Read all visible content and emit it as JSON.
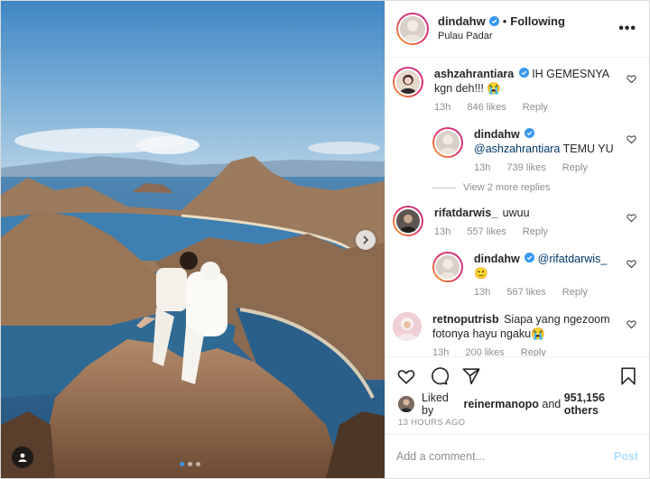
{
  "colors": {
    "accent": "#3897f0",
    "muted": "#8e8e8e",
    "mention": "#00376b"
  },
  "post": {
    "author": "dindahw",
    "separator": "•",
    "follow_state": "Following",
    "location": "Pulau Padar",
    "more_icon": "ellipsis-icon",
    "carousel": {
      "slide_count": 3,
      "active_index": 0
    }
  },
  "comments": [
    {
      "user": "ashzahrantiara",
      "verified": true,
      "mention": "",
      "text": "IH GEMESNYA kgn deh!!! 😭",
      "time": "13h",
      "likes": "846 likes",
      "reply_label": "Reply"
    },
    {
      "user": "dindahw",
      "verified": true,
      "mention": "@ashzahrantiara",
      "text": "TEMU YU",
      "time": "13h",
      "likes": "739 likes",
      "reply_label": "Reply"
    },
    {
      "view_replies": "View 2 more replies"
    },
    {
      "user": "rifatdarwis_",
      "verified": false,
      "mention": "",
      "text": "uwuu",
      "time": "13h",
      "likes": "557 likes",
      "reply_label": "Reply"
    },
    {
      "user": "dindahw",
      "verified": true,
      "mention": "@rifatdarwis_",
      "text": "🙂",
      "time": "13h",
      "likes": "567 likes",
      "reply_label": "Reply"
    },
    {
      "user": "retnoputrisb",
      "verified": false,
      "mention": "",
      "text": "Siapa yang ngezoom fotonya hayu ngaku😭",
      "time": "13h",
      "likes": "200 likes",
      "reply_label": "Reply"
    }
  ],
  "likes": {
    "prefix": "Liked by",
    "user": "reinermanopo",
    "joiner": "and",
    "others": "951,156 others"
  },
  "timestamp": "13 HOURS AGO",
  "composer": {
    "placeholder": "Add a comment...",
    "post_label": "Post"
  }
}
